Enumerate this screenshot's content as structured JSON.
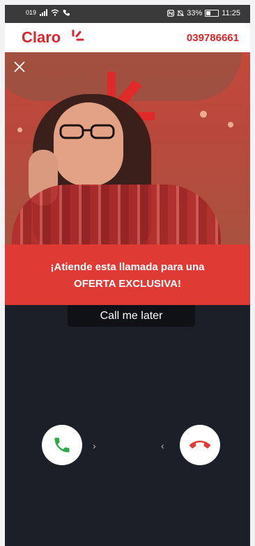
{
  "status_bar": {
    "carrier": "019",
    "battery": "33%",
    "time": "11:25",
    "icons": [
      "signal-icon",
      "wifi-icon",
      "call-icon",
      "nfc-icon",
      "mute-icon",
      "battery-icon"
    ]
  },
  "header": {
    "logo_text": "Claro",
    "phone_number": "039786661"
  },
  "banner": {
    "close_icon": "close-icon"
  },
  "offer": {
    "line1": "¡Atiende esta llamada para una",
    "line2": "OFERTA EXCLUSIVA!"
  },
  "actions": {
    "call_later": "Call me later",
    "answer_icon": "phone-answer-icon",
    "decline_icon": "phone-decline-icon",
    "chevron_right": "›",
    "chevron_left": "‹"
  },
  "colors": {
    "brand": "#d9262b",
    "offer_bg": "#df3a33",
    "answer": "#2aa84a",
    "decline": "#e23b34",
    "background": "#1b1f27"
  }
}
